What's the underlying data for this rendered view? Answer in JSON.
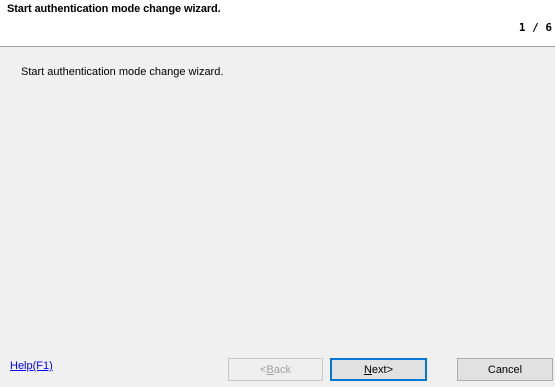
{
  "header": {
    "title": "Start authentication mode change wizard.",
    "step": "1 / 6"
  },
  "main": {
    "description": "Start authentication mode change wizard."
  },
  "footer": {
    "help_label": "Help(F1)",
    "back": {
      "mnemonic": "B",
      "rest": "ack",
      "prefix": "<",
      "enabled": false
    },
    "next": {
      "mnemonic": "N",
      "rest": "ext>"
    },
    "cancel_label": "Cancel"
  },
  "colors": {
    "link": "#0000ff",
    "focus_border": "#0078d7",
    "disabled_text": "#a0a0a0",
    "background": "#f0f0f0",
    "header_background": "#ffffff"
  }
}
